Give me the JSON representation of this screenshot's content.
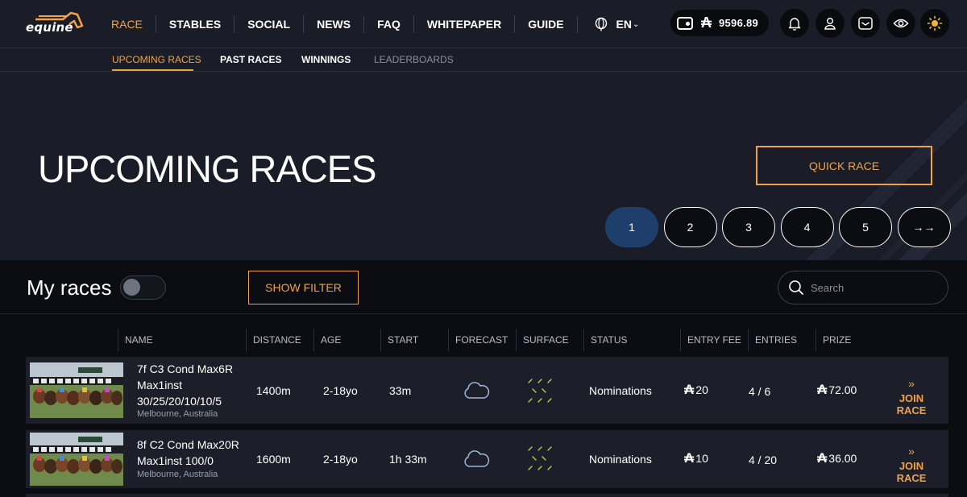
{
  "header": {
    "logo_text": "equine",
    "nav": [
      "RACE",
      "STABLES",
      "SOCIAL",
      "NEWS",
      "FAQ",
      "WHITEPAPER",
      "GUIDE"
    ],
    "active_nav": "RACE",
    "language": "EN",
    "currency_symbol": "₳",
    "wallet_balance": "9596.89",
    "icons": [
      "wallet-icon",
      "bell-icon",
      "user-icon",
      "mail-icon",
      "eye-icon",
      "sun-icon"
    ]
  },
  "subnav": {
    "items": [
      "UPCOMING RACES",
      "PAST RACES",
      "WINNINGS",
      "LEADERBOARDS"
    ],
    "active": "UPCOMING RACES"
  },
  "hero": {
    "title": "UPCOMING RACES",
    "quick_race_label": "QUICK RACE",
    "pages": [
      "1",
      "2",
      "3",
      "4",
      "5"
    ],
    "current_page": "1",
    "next_label": "→→"
  },
  "filters": {
    "my_races_label": "My races",
    "my_races_toggle": false,
    "show_filter_label": "SHOW FILTER",
    "search_placeholder": "Search"
  },
  "table": {
    "columns": [
      "NAME",
      "DISTANCE",
      "AGE",
      "START",
      "FORECAST",
      "SURFACE",
      "STATUS",
      "ENTRY FEE",
      "ENTRIES",
      "PRIZE"
    ],
    "rows": [
      {
        "name_line1": "7f C3 Cond Max6R",
        "name_line2": "Max1inst",
        "name_line3": "30/25/20/10/10/5",
        "location": "Melbourne, Australia",
        "distance": "1400m",
        "age": "2-18yo",
        "start": "33m",
        "forecast_icon": "cloud-icon",
        "surface_icon": "turf-icon",
        "status": "Nominations",
        "entry_fee": "20",
        "entries": "4 / 6",
        "prize": "72.00",
        "join_label": "JOIN RACE"
      },
      {
        "name_line1": "8f C2 Cond Max20R",
        "name_line2": "Max1inst 100/0",
        "location": "Melbourne, Australia",
        "distance": "1600m",
        "age": "2-18yo",
        "start": "1h 33m",
        "forecast_icon": "cloud-icon",
        "surface_icon": "turf-icon",
        "status": "Nominations",
        "entry_fee": "10",
        "entries": "4 / 20",
        "prize": "36.00",
        "join_label": "JOIN RACE"
      }
    ]
  },
  "colors": {
    "accent": "#f0a24a",
    "page_active": "#1e3f6b",
    "nav_bg": "#1a1d27",
    "row_bg": "#1c1f29",
    "surface_icon": "#b8d24a"
  }
}
